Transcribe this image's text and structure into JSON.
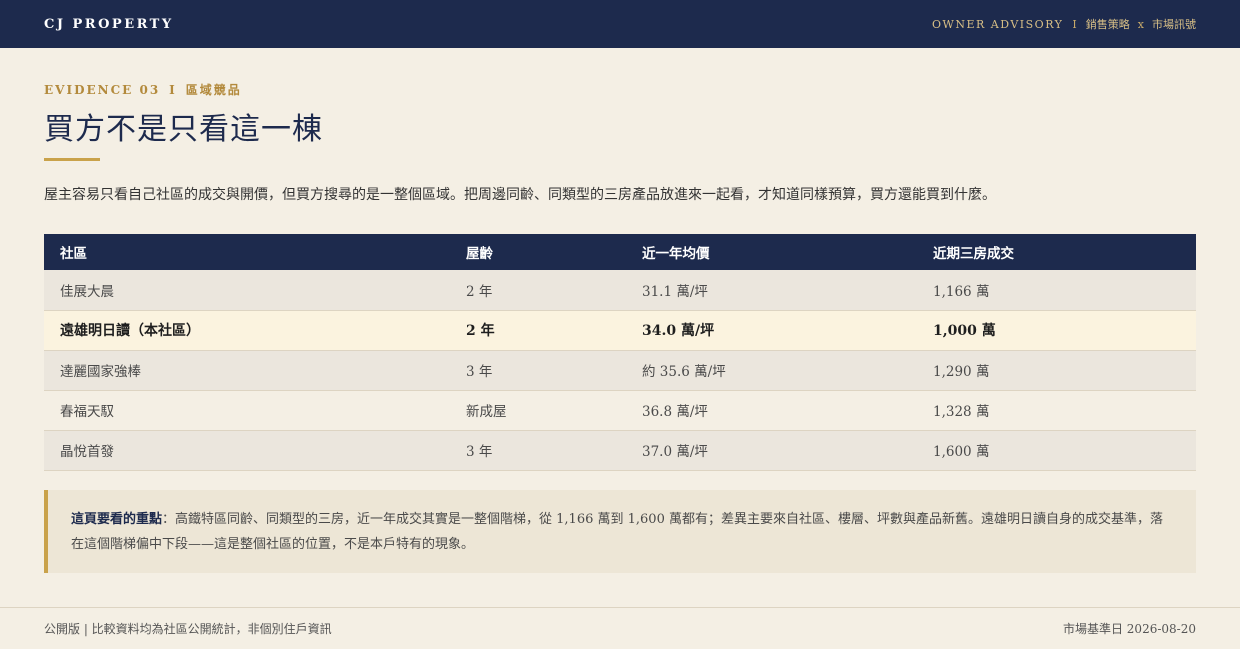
{
  "header": {
    "brand": "CJ PROPERTY",
    "nav_advisory": "OWNER ADVISORY",
    "nav_separator": "I",
    "nav_sales": "銷售策略",
    "nav_x": "x",
    "nav_market": "市場訊號"
  },
  "section": {
    "eyebrow_code": "EVIDENCE 03",
    "eyebrow_bar": "I",
    "eyebrow_label": "區域競品",
    "title": "買方不是只看這一棟",
    "intro": "屋主容易只看自己社區的成交與開價，但買方搜尋的是一整個區域。把周邊同齡、同類型的三房產品放進來一起看，才知道同樣預算，買方還能買到什麼。"
  },
  "table": {
    "headers": [
      "社區",
      "屋齡",
      "近一年均價",
      "近期三房成交"
    ],
    "rows": [
      {
        "name": "佳展大晨",
        "age": "2 年",
        "avg": "31.1 萬/坪",
        "recent": "1,166 萬"
      },
      {
        "name": "遠雄明日讀（本社區）",
        "age": "2 年",
        "avg": "34.0 萬/坪",
        "recent": "1,000 萬"
      },
      {
        "name": "達麗國家強棒",
        "age": "3 年",
        "avg": "約 35.6 萬/坪",
        "recent": "1,290 萬"
      },
      {
        "name": "春福天馭",
        "age": "新成屋",
        "avg": "36.8 萬/坪",
        "recent": "1,328 萬"
      },
      {
        "name": "晶悅首發",
        "age": "3 年",
        "avg": "37.0 萬/坪",
        "recent": "1,600 萬"
      }
    ]
  },
  "note": {
    "lead": "這頁要看的重點",
    "text": "：高鐵特區同齡、同類型的三房，近一年成交其實是一整個階梯，從 1,166 萬到 1,600 萬都有；差異主要來自社區、樓層、坪數與產品新舊。遠雄明日讀自身的成交基準，落在這個階梯偏中下段——這是整個社區的位置，不是本戶特有的現象。"
  },
  "footer": {
    "left": "公開版 | 比較資料均為社區公開統計，非個別住戶資訊",
    "right": "市場基準日 2026-08-20"
  },
  "colors": {
    "navy": "#1d2a4d",
    "gold": "#c9a24a",
    "background": "#f4efe4",
    "highlight_row": "#fbf3df"
  }
}
